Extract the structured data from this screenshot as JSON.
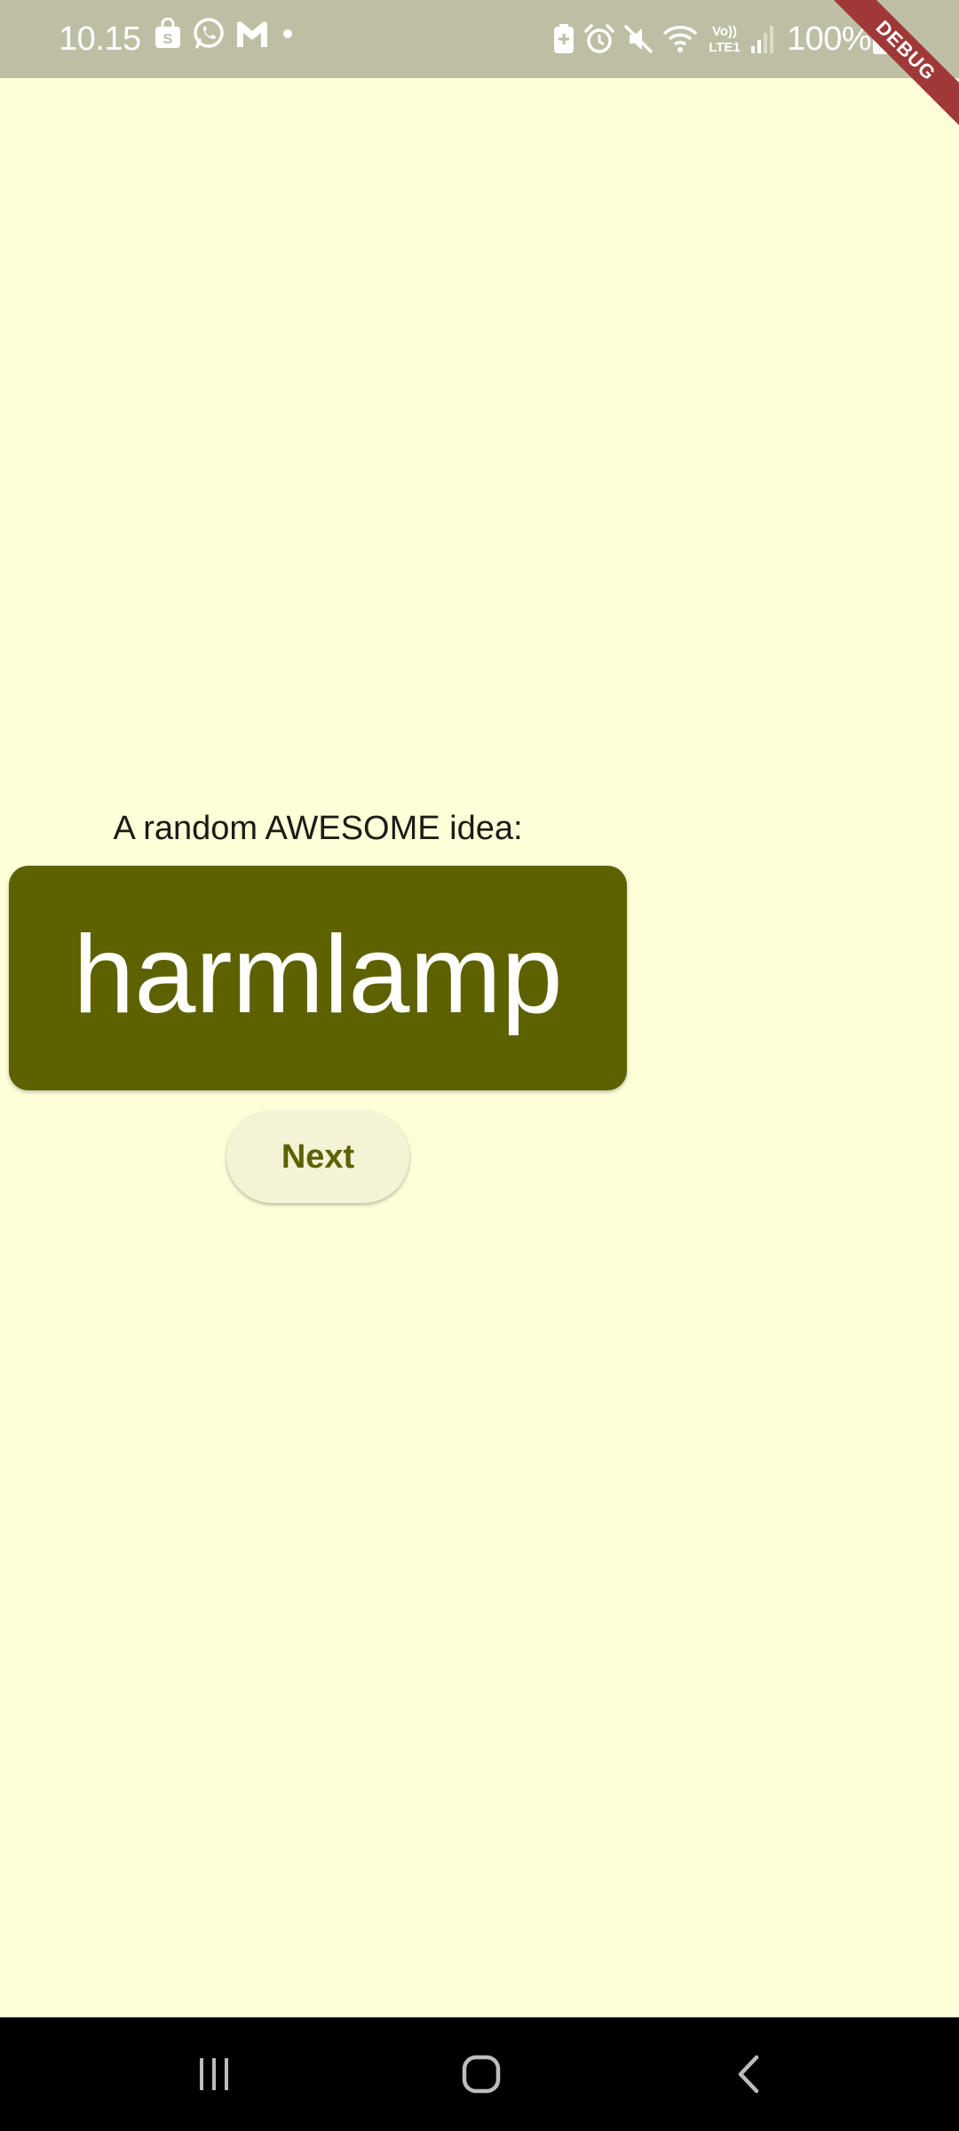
{
  "status_bar": {
    "time": "10.15",
    "battery": "100%",
    "left_icons": [
      "shopping-bag-icon",
      "whatsapp-icon",
      "gmail-icon",
      "dot-icon"
    ],
    "right_icons": [
      "battery-saver-icon",
      "alarm-icon",
      "mute-icon",
      "wifi-icon",
      "volte-icon",
      "signal-icon",
      "charging-icon"
    ],
    "background_color": "#BEBEA4"
  },
  "debug_banner": {
    "label": "DEBUG",
    "color": "#A03838"
  },
  "main": {
    "label": "A random AWESOME idea:",
    "idea": "harmlamp",
    "next_button": "Next",
    "background_color": "#FEFED8",
    "card_color": "#5E6100",
    "button_color": "#F4F3D5"
  },
  "nav_bar": {
    "buttons": [
      "recent-apps-icon",
      "home-icon",
      "back-icon"
    ]
  }
}
